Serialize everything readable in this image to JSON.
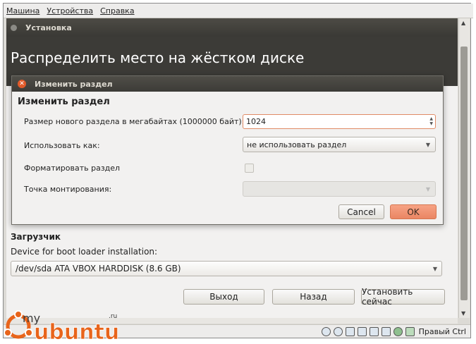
{
  "menubar": {
    "items": [
      "Машина",
      "Устройства",
      "Справка"
    ]
  },
  "installer": {
    "window_title": "Установка",
    "page_title": "Распределить место на жёстком диске",
    "bootloader_heading": "Загрузчик",
    "bootloader_device_label": "Device for boot loader installation:",
    "bootloader_device_value": "/dev/sda ATA VBOX HARDDISK (8.6 GB)",
    "buttons": {
      "quit": "Выход",
      "back": "Назад",
      "install_now": "Установить сейчас"
    }
  },
  "dialog": {
    "title": "Изменить раздел",
    "heading": "Изменить раздел",
    "size_label": "Размер нового раздела в мегабайтах (1000000 байт):",
    "size_value": "1024",
    "use_as_label": "Использовать как:",
    "use_as_value": "не использовать раздел",
    "format_label": "Форматировать раздел",
    "format_checked": false,
    "mount_label": "Точка монтирования:",
    "mount_value": "",
    "cancel_label": "Cancel",
    "ok_label": "OK"
  },
  "statusbar": {
    "host_key": "Правый Ctrl"
  },
  "watermark": {
    "text": "my ubuntu .ru"
  },
  "colors": {
    "accent": "#e15a2a",
    "ok_button": "#ea8663",
    "header_bg": "#3c3b37"
  }
}
